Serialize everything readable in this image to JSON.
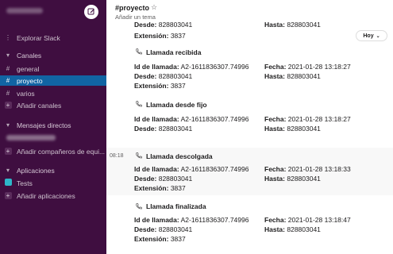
{
  "sidebar": {
    "explore": "Explorar Slack",
    "channels_header": "Canales",
    "channels": [
      "general",
      "proyecto",
      "varios"
    ],
    "add_channels": "Añadir canales",
    "dm_header": "Mensajes directos",
    "add_teammates": "Añadir compañeros de equi...",
    "apps_header": "Aplicaciones",
    "apps": [
      "Tests"
    ],
    "add_apps": "Añadir aplicaciones"
  },
  "channel": {
    "name": "#proyecto",
    "topic": "Añadir un tema"
  },
  "today_label": "Hoy",
  "labels": {
    "id": "Id de llamada:",
    "desde": "Desde:",
    "hasta": "Hasta:",
    "fecha": "Fecha:",
    "extension": "Extensión:"
  },
  "partial": {
    "extension": "3837",
    "desde": "828803041",
    "hasta": "828803041"
  },
  "messages": [
    {
      "title": "Llamada recibida",
      "time": "",
      "id": "A2-1611836307.74996",
      "fecha": "2021-01-28 13:18:27",
      "desde": "828803041",
      "hasta": "828803041",
      "extension": "3837"
    },
    {
      "title": "Llamada desde fijo",
      "time": "",
      "id": "A2-1611836307.74996",
      "fecha": "2021-01-28 13:18:27",
      "desde": "828803041",
      "hasta": "828803041",
      "extension": ""
    },
    {
      "title": "Llamada descolgada",
      "time": "08:18",
      "id": "A2-1611836307.74996",
      "fecha": "2021-01-28 13:18:33",
      "desde": "828803041",
      "hasta": "828803041",
      "extension": "3837"
    },
    {
      "title": "Llamada finalizada",
      "time": "",
      "id": "A2-1611836307.74996",
      "fecha": "2021-01-28 13:18:47",
      "desde": "828803041",
      "hasta": "828803041",
      "extension": "3837"
    }
  ],
  "colors": {
    "sidebar_bg": "#3f0e40",
    "active_bg": "#1164a3"
  }
}
